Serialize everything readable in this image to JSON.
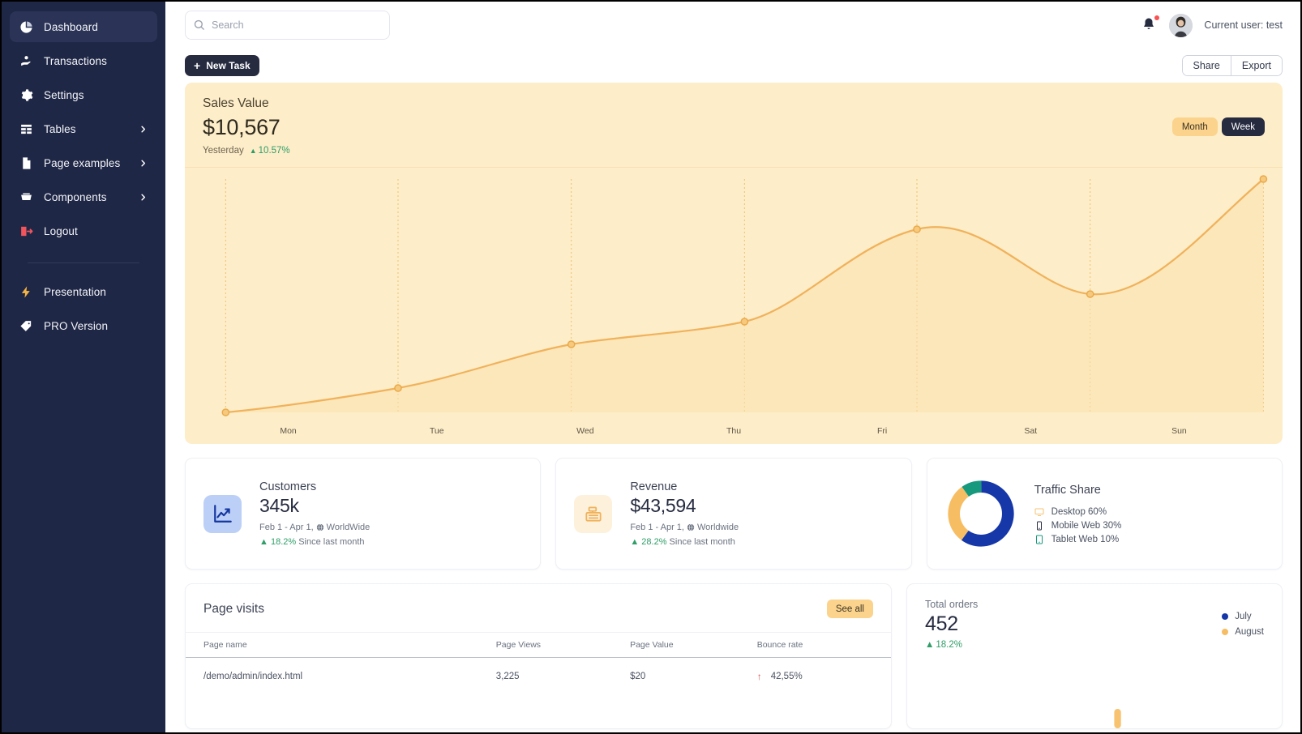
{
  "sidebar": {
    "items": [
      {
        "label": "Dashboard",
        "icon": "pie-chart-icon",
        "active": true,
        "chevron": false
      },
      {
        "label": "Transactions",
        "icon": "hand-coin-icon",
        "active": false,
        "chevron": false
      },
      {
        "label": "Settings",
        "icon": "gear-icon",
        "active": false,
        "chevron": false
      },
      {
        "label": "Tables",
        "icon": "table-icon",
        "active": false,
        "chevron": true
      },
      {
        "label": "Page examples",
        "icon": "document-icon",
        "active": false,
        "chevron": true
      },
      {
        "label": "Components",
        "icon": "components-icon",
        "active": false,
        "chevron": true
      },
      {
        "label": "Logout",
        "icon": "logout-icon",
        "active": false,
        "chevron": false
      }
    ],
    "secondary_items": [
      {
        "label": "Presentation",
        "icon": "lightning-icon"
      },
      {
        "label": "PRO Version",
        "icon": "tag-icon"
      }
    ],
    "colors": {
      "background": "#1f2746",
      "active_background": "#2b3457",
      "logout_icon": "#f0545c",
      "lightning_icon": "#f5b544"
    }
  },
  "topbar": {
    "search": {
      "placeholder": "Search",
      "value": "",
      "icon": "search-icon"
    },
    "notifications_icon": "bell-icon",
    "has_notification_badge": true,
    "avatar_icon": "avatar",
    "user_label": "Current user: test"
  },
  "actionbar": {
    "new_task_label": "New Task",
    "new_task_icon": "plus-icon",
    "share_label": "Share",
    "export_label": "Export"
  },
  "sales_card": {
    "title": "Sales Value",
    "value": "$10,567",
    "period_label": "Yesterday",
    "delta": "10.57%",
    "delta_direction": "up",
    "range_options": [
      {
        "label": "Month",
        "active": false
      },
      {
        "label": "Week",
        "active": true
      }
    ],
    "colors": {
      "background": "#fdedc9",
      "line": "#f3b85b",
      "fill": "#fbe0ae"
    }
  },
  "chart_data": {
    "type": "line",
    "title": "Sales Value",
    "categories": [
      "Mon",
      "Tue",
      "Wed",
      "Thu",
      "Fri",
      "Sat",
      "Sun"
    ],
    "values": [
      10,
      28,
      46,
      56,
      82,
      68,
      100
    ],
    "series": [
      {
        "name": "Sales Value",
        "values": [
          10,
          28,
          46,
          56,
          82,
          68,
          100
        ]
      }
    ],
    "xlabel": "",
    "ylabel": "",
    "ylim": [
      0,
      110
    ],
    "grid": "vertical-dotted",
    "legend": "none",
    "markers": true,
    "smooth": true,
    "line_color": "#f3b85b",
    "area_fill": "#fbe0ae"
  },
  "stats": [
    {
      "title": "Customers",
      "value": "345k",
      "range": "Feb 1 - Apr 1,",
      "scope": "WorldWide",
      "delta": "18.2%",
      "delta_direction": "up",
      "delta_note": "Since last month",
      "icon": "chart-line-icon",
      "icon_style": "blue"
    },
    {
      "title": "Revenue",
      "value": "$43,594",
      "range": "Feb 1 - Apr 1,",
      "scope": "Worldwide",
      "delta": "28.2%",
      "delta_direction": "up",
      "delta_note": "Since last month",
      "icon": "cash-register-icon",
      "icon_style": "amber"
    }
  ],
  "traffic_share": {
    "title": "Traffic Share",
    "chart_type": "donut",
    "items": [
      {
        "label": "Desktop 60%",
        "value": 60,
        "color": "#1537a8",
        "icon": "desktop-icon",
        "icon_color": "#f5c373"
      },
      {
        "label": "Mobile Web 30%",
        "value": 30,
        "color": "#f7bd63",
        "icon": "mobile-icon",
        "icon_color": "#262b40"
      },
      {
        "label": "Tablet Web 10%",
        "value": 10,
        "color": "#16997d",
        "icon": "tablet-icon",
        "icon_color": "#16997d"
      }
    ]
  },
  "page_visits": {
    "title": "Page visits",
    "see_all_label": "See all",
    "columns": [
      "Page name",
      "Page Views",
      "Page Value",
      "Bounce rate"
    ],
    "rows": [
      {
        "page_name": "/demo/admin/index.html",
        "page_views": "3,225",
        "page_value": "$20",
        "bounce_rate": "42,55%",
        "bounce_direction": "up"
      }
    ]
  },
  "total_orders": {
    "title": "Total orders",
    "value": "452",
    "delta": "18.2%",
    "delta_direction": "up",
    "legend": [
      {
        "label": "July",
        "color": "#1537a8"
      },
      {
        "label": "August",
        "color": "#f7bd63"
      }
    ],
    "chart_type": "bar"
  }
}
